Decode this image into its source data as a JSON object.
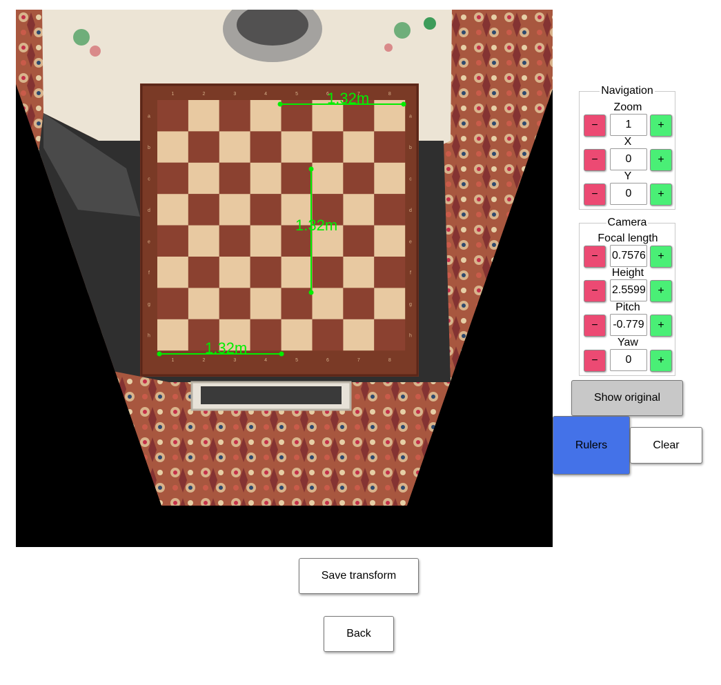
{
  "navigation": {
    "legend": "Navigation",
    "controls": [
      {
        "label": "Zoom",
        "value": "1"
      },
      {
        "label": "X",
        "value": "0"
      },
      {
        "label": "Y",
        "value": "0"
      }
    ]
  },
  "camera": {
    "legend": "Camera",
    "controls": [
      {
        "label": "Focal length",
        "value": "0.7576"
      },
      {
        "label": "Height",
        "value": "2.5599"
      },
      {
        "label": "Pitch",
        "value": "-0.779"
      },
      {
        "label": "Yaw",
        "value": "0"
      }
    ]
  },
  "buttons": {
    "minus": "−",
    "plus": "+",
    "show_original": "Show original",
    "rulers": "Rulers",
    "clear": "Clear",
    "save_transform": "Save transform",
    "back": "Back"
  },
  "rulers": [
    {
      "label": "1.32m",
      "orientation": "horizontal-top"
    },
    {
      "label": "1.32m",
      "orientation": "vertical"
    },
    {
      "label": "1.32m",
      "orientation": "horizontal-bottom"
    }
  ],
  "board": {
    "files": [
      "1",
      "2",
      "3",
      "4",
      "5",
      "6",
      "7",
      "8"
    ],
    "ranks": [
      "h",
      "g",
      "f",
      "e",
      "d",
      "c",
      "b",
      "a"
    ]
  },
  "colors": {
    "ruler": "#00ee00",
    "minus_button": "#ec4a73",
    "plus_button": "#4aef76",
    "rulers_active": "#4472e8",
    "show_original": "#c8c8c8",
    "light_square": "#e8c9a1",
    "dark_square": "#8b4130",
    "board_frame": "#7a3a26"
  }
}
